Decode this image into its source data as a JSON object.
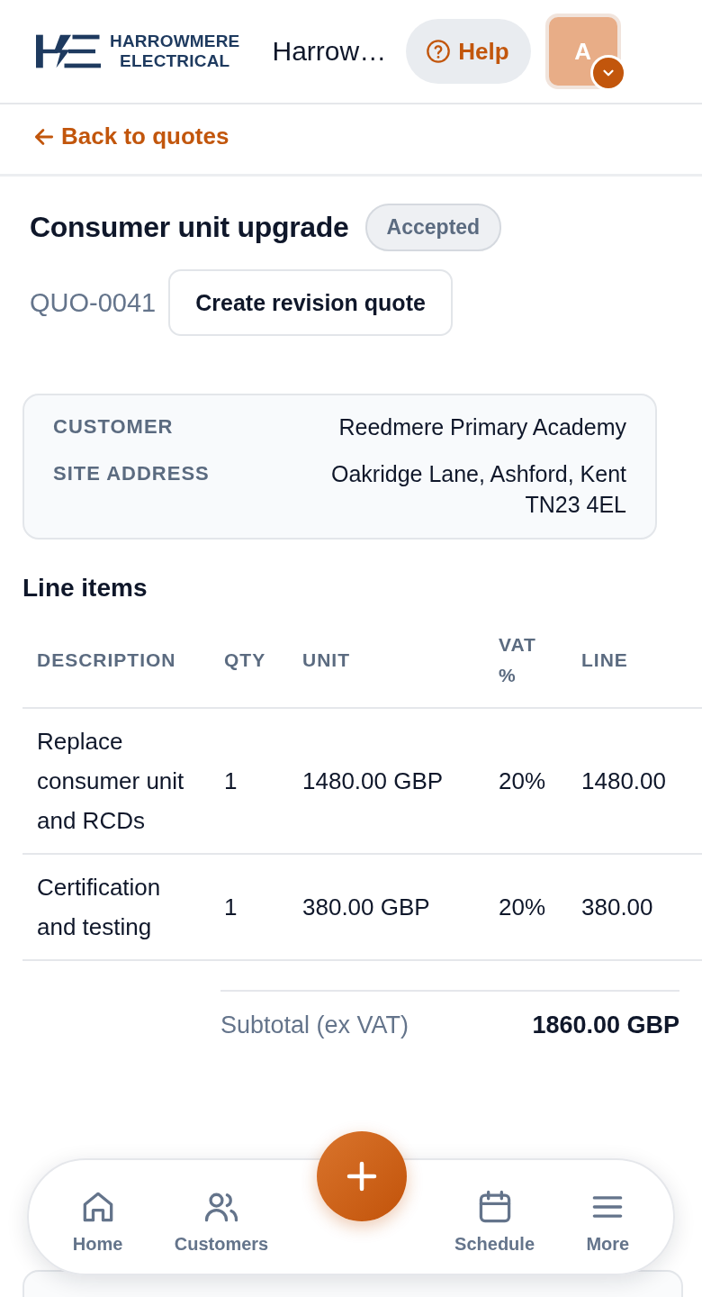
{
  "header": {
    "brand_line_1": "HARROWMERE",
    "brand_line_2": "ELECTRICAL",
    "title": "Harrow…",
    "help_label": "Help",
    "avatar_initial": "A"
  },
  "back_link": "Back to quotes",
  "quote": {
    "title": "Consumer unit upgrade",
    "status": "Accepted",
    "number": "QUO-0041",
    "revision_button": "Create revision quote"
  },
  "details": [
    {
      "label": "CUSTOMER",
      "value": "Reedmere Primary Academy"
    },
    {
      "label": "SITE ADDRESS",
      "value": "Oakridge Lane, Ashford, Kent TN23 4EL"
    }
  ],
  "line_items": {
    "title": "Line items",
    "columns": [
      "DESCRIPTION",
      "QTY",
      "UNIT",
      "VAT %",
      "LINE"
    ],
    "rows": [
      [
        "Replace consumer unit and RCDs",
        "1",
        "1480.00 GBP",
        "20%",
        "1480.00"
      ],
      [
        "Certification and testing",
        "1",
        "380.00 GBP",
        "20%",
        "380.00"
      ]
    ]
  },
  "totals": [
    {
      "label": "Subtotal (ex VAT)",
      "value": "1860.00 GBP"
    }
  ],
  "bottom_nav": [
    {
      "kind": "home",
      "label": "Home"
    },
    {
      "kind": "customers",
      "label": "Customers"
    },
    {
      "kind": "add"
    },
    {
      "kind": "schedule",
      "label": "Schedule"
    },
    {
      "kind": "more",
      "label": "More"
    }
  ]
}
